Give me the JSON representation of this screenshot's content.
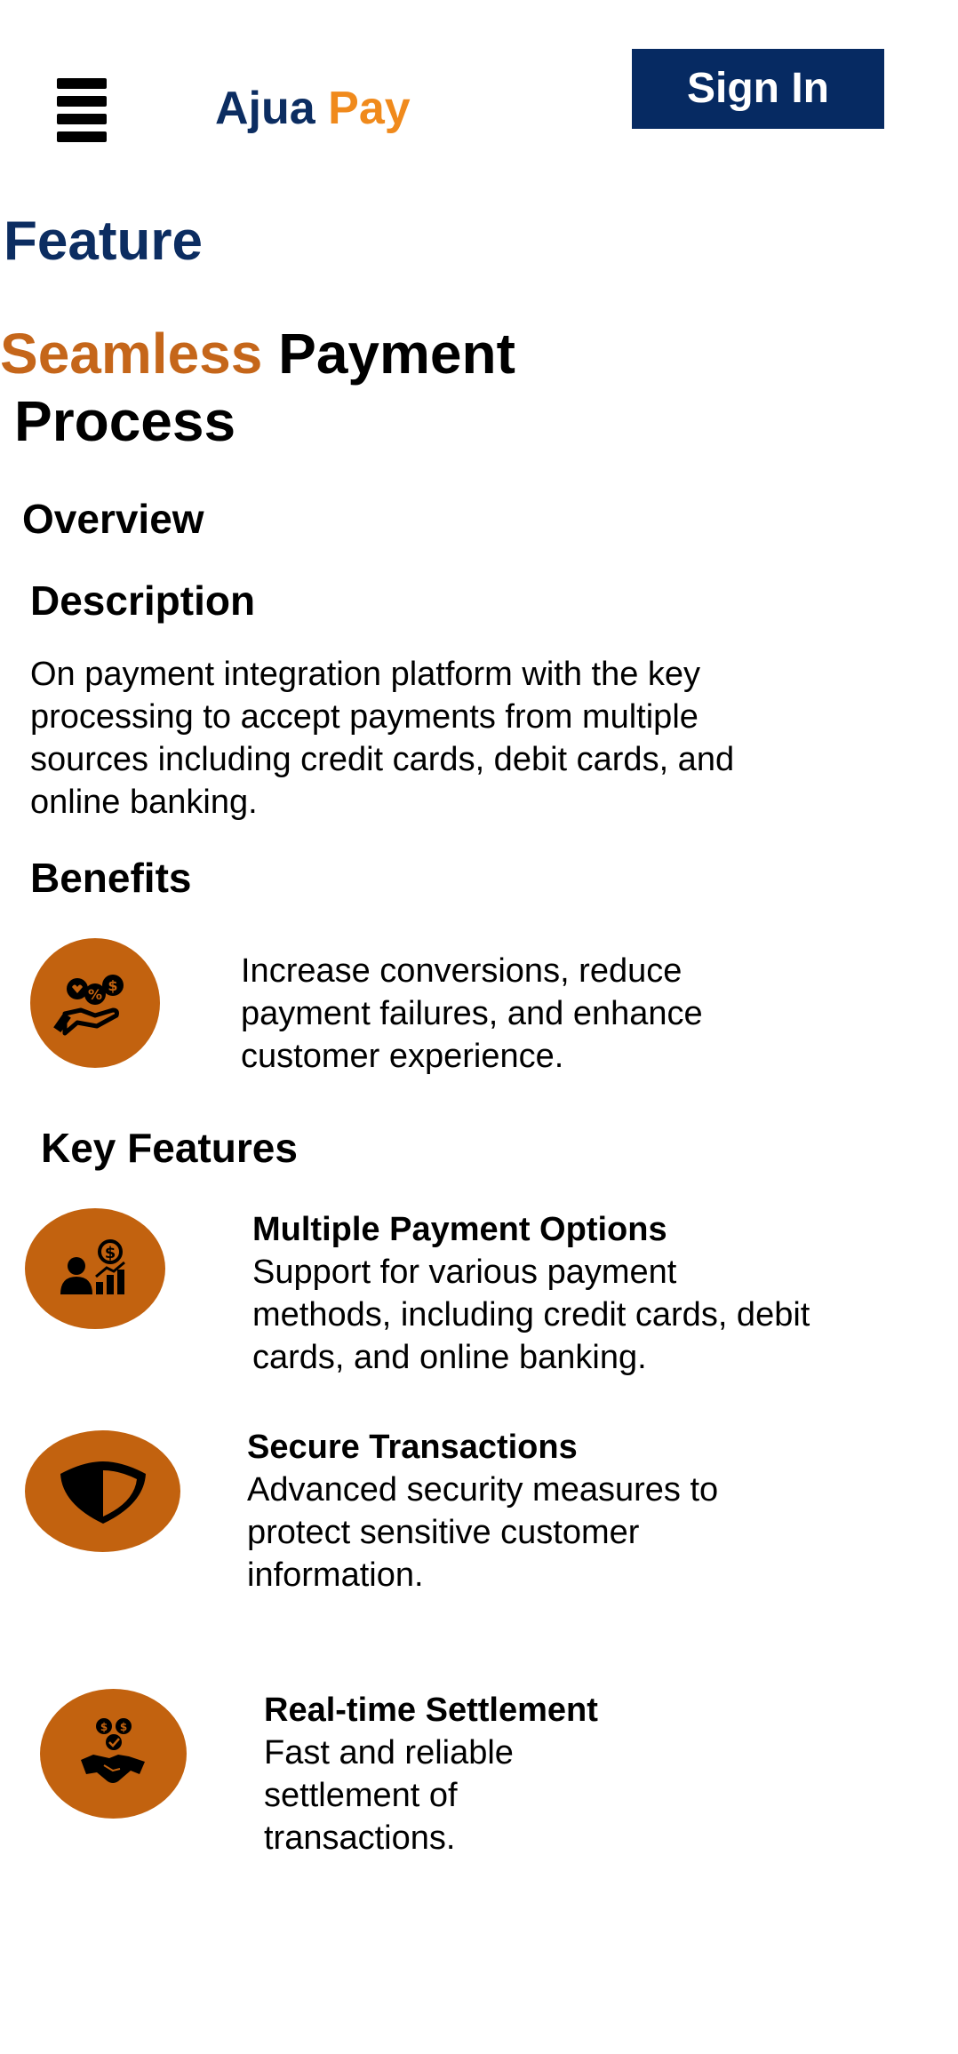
{
  "header": {
    "menu_icon": "hamburger-menu-icon",
    "brand": {
      "part1": "Ajua",
      "part2": "Pay"
    },
    "sign_in_label": "Sign In"
  },
  "page": {
    "section_label": "Feature",
    "headline": {
      "accent": "Seamless",
      "rest_line1": "Payment",
      "rest_line2": "Process"
    },
    "overview_title": "Overview",
    "description": {
      "title": "Description",
      "text": "On payment integration platform with the key processing to accept payments from multiple sources including credit cards, debit cards, and online banking."
    },
    "benefits": {
      "title": "Benefits",
      "icon": "hand-with-coins-icon",
      "text": "Increase conversions, reduce payment failures, and enhance customer experience."
    },
    "key_features": {
      "title": "Key Features",
      "items": [
        {
          "icon": "user-dollar-growth-icon",
          "title": "Multiple Payment Options",
          "description": "Support for various payment methods, including credit cards, debit cards, and online banking."
        },
        {
          "icon": "shield-icon",
          "title": "Secure Transactions",
          "description": "Advanced security measures to protect sensitive customer information."
        },
        {
          "icon": "handshake-coins-icon",
          "title": "Real-time Settlement",
          "description": "Fast and reliable settlement of transactions."
        }
      ]
    }
  },
  "colors": {
    "navy": "#0c2d61",
    "sign_in_bg": "#062a62",
    "brand_orange": "#f08a1c",
    "accent_orange": "#c5661a",
    "icon_circle": "#c2620f"
  }
}
